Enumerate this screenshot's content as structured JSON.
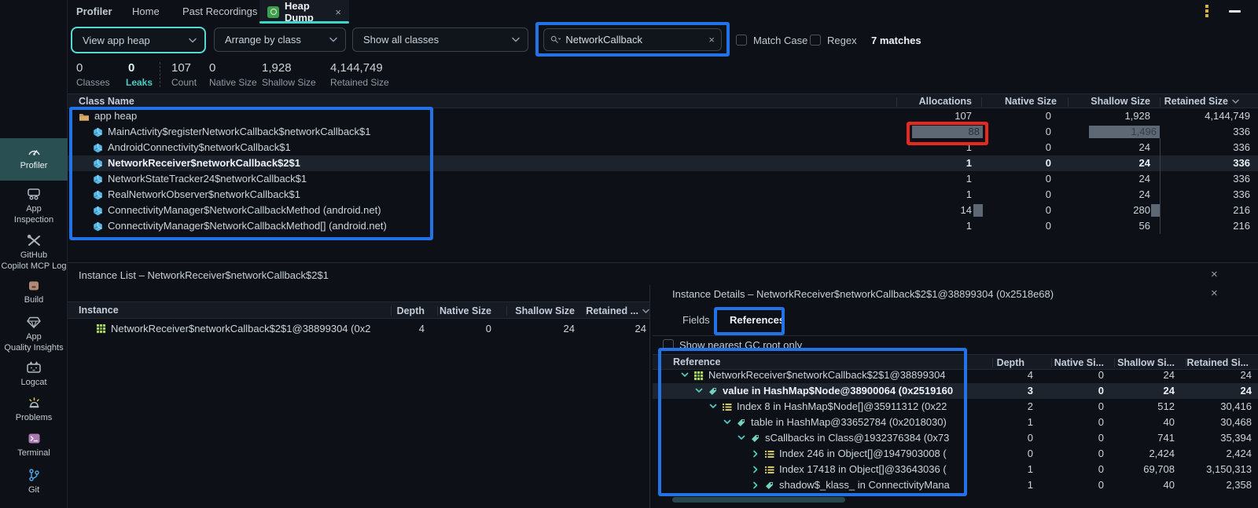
{
  "colors": {
    "accent_teal": "#3bd5cb",
    "annotation_blue": "#2273e8",
    "annotation_red": "#e8281e",
    "selection_bg": "#1c232d",
    "bar_gray": "#5d6874"
  },
  "tabbar": {
    "window_title": "Profiler",
    "tab_home": "Home",
    "tab_past": "Past Recordings",
    "active_tab": "Heap Dump",
    "close_label": "×"
  },
  "toolbar": {
    "heap_dropdown": "View app heap",
    "arrange_dropdown": "Arrange by class",
    "classes_dropdown": "Show all classes",
    "search_value": "NetworkCallback",
    "search_clear": "×",
    "match_case": "Match Case",
    "regex": "Regex",
    "matches": "7 matches"
  },
  "stats": {
    "items": [
      {
        "value": "0",
        "label": "Classes"
      },
      {
        "value": "0",
        "label": "Leaks"
      },
      {
        "value": "107",
        "label": "Count"
      },
      {
        "value": "0",
        "label": "Native Size"
      },
      {
        "value": "1,928",
        "label": "Shallow Size"
      },
      {
        "value": "4,144,749",
        "label": "Retained Size"
      }
    ]
  },
  "class_table": {
    "columns": {
      "name": "Class Name",
      "alloc": "Allocations",
      "native": "Native Size",
      "shallow": "Shallow Size",
      "retained": "Retained Size"
    },
    "rows": [
      {
        "name": "app heap",
        "alloc": "107",
        "native": "0",
        "shallow": "1,928",
        "retained": "4,144,749"
      },
      {
        "name": "MainActivity$registerNetworkCallback$networkCallback$1",
        "alloc": "88",
        "native": "0",
        "shallow": "1,496",
        "retained": "336"
      },
      {
        "name": "AndroidConnectivity$networkCallback$1",
        "alloc": "1",
        "native": "0",
        "shallow": "24",
        "retained": "336"
      },
      {
        "name": "NetworkReceiver$networkCallback$2$1",
        "alloc": "1",
        "native": "0",
        "shallow": "24",
        "retained": "336"
      },
      {
        "name": "NetworkStateTracker24$networkCallback$1",
        "alloc": "1",
        "native": "0",
        "shallow": "24",
        "retained": "336"
      },
      {
        "name": "RealNetworkObserver$networkCallback$1",
        "alloc": "1",
        "native": "0",
        "shallow": "24",
        "retained": "336"
      },
      {
        "name": "ConnectivityManager$NetworkCallbackMethod (android.net)",
        "alloc": "14",
        "native": "0",
        "shallow": "280",
        "retained": "216"
      },
      {
        "name": "ConnectivityManager$NetworkCallbackMethod[] (android.net)",
        "alloc": "1",
        "native": "0",
        "shallow": "56",
        "retained": "216"
      }
    ]
  },
  "sidebar": {
    "items": [
      {
        "line1": "Profiler",
        "line2": ""
      },
      {
        "line1": "App",
        "line2": "Inspection"
      },
      {
        "line1": "GitHub",
        "line2": "Copilot MCP Log"
      },
      {
        "line1": "Build",
        "line2": ""
      },
      {
        "line1": "App",
        "line2": "Quality Insights"
      },
      {
        "line1": "Logcat",
        "line2": ""
      },
      {
        "line1": "Problems",
        "line2": ""
      },
      {
        "line1": "Terminal",
        "line2": ""
      },
      {
        "line1": "Git",
        "line2": ""
      }
    ]
  },
  "instance_list": {
    "title": "Instance List – NetworkReceiver$networkCallback$2$1",
    "close_label": "×",
    "columns": {
      "instance": "Instance",
      "depth": "Depth",
      "native": "Native Size",
      "shallow": "Shallow Size",
      "retained": "Retained ..."
    },
    "row": {
      "name": "NetworkReceiver$networkCallback$2$1@38899304 (0x2",
      "depth": "4",
      "native": "0",
      "shallow": "24",
      "retained": "24"
    }
  },
  "instance_details": {
    "title": "Instance Details – NetworkReceiver$networkCallback$2$1@38899304 (0x2518e68)",
    "close_label": "×",
    "tab_fields": "Fields",
    "tab_references": "References",
    "gc_root_label": "Show nearest GC root only",
    "columns": {
      "reference": "Reference",
      "depth": "Depth",
      "native": "Native Si...",
      "shallow": "Shallow Si...",
      "retained": "Retained Si..."
    },
    "rows": [
      {
        "text": "NetworkReceiver$networkCallback$2$1@38899304",
        "depth": "4",
        "native": "0",
        "shallow": "24",
        "retained": "24"
      },
      {
        "text": "value in HashMap$Node@38900064 (0x2519160",
        "depth": "3",
        "native": "0",
        "shallow": "24",
        "retained": "24"
      },
      {
        "text": "Index 8 in HashMap$Node[]@35911312 (0x22",
        "depth": "2",
        "native": "0",
        "shallow": "512",
        "retained": "30,416"
      },
      {
        "text": "table in HashMap@33652784 (0x2018030)",
        "depth": "1",
        "native": "0",
        "shallow": "40",
        "retained": "30,468"
      },
      {
        "text": "sCallbacks in Class@1932376384 (0x73",
        "depth": "0",
        "native": "0",
        "shallow": "741",
        "retained": "35,394"
      },
      {
        "text": "Index 246 in Object[]@1947903008 (",
        "depth": "0",
        "native": "0",
        "shallow": "2,424",
        "retained": "2,424"
      },
      {
        "text": "Index 17418 in Object[]@33643036 (",
        "depth": "1",
        "native": "0",
        "shallow": "69,708",
        "retained": "3,150,313"
      },
      {
        "text": "shadow$_klass_ in ConnectivityMana",
        "depth": "1",
        "native": "0",
        "shallow": "40",
        "retained": "2,358"
      }
    ]
  }
}
